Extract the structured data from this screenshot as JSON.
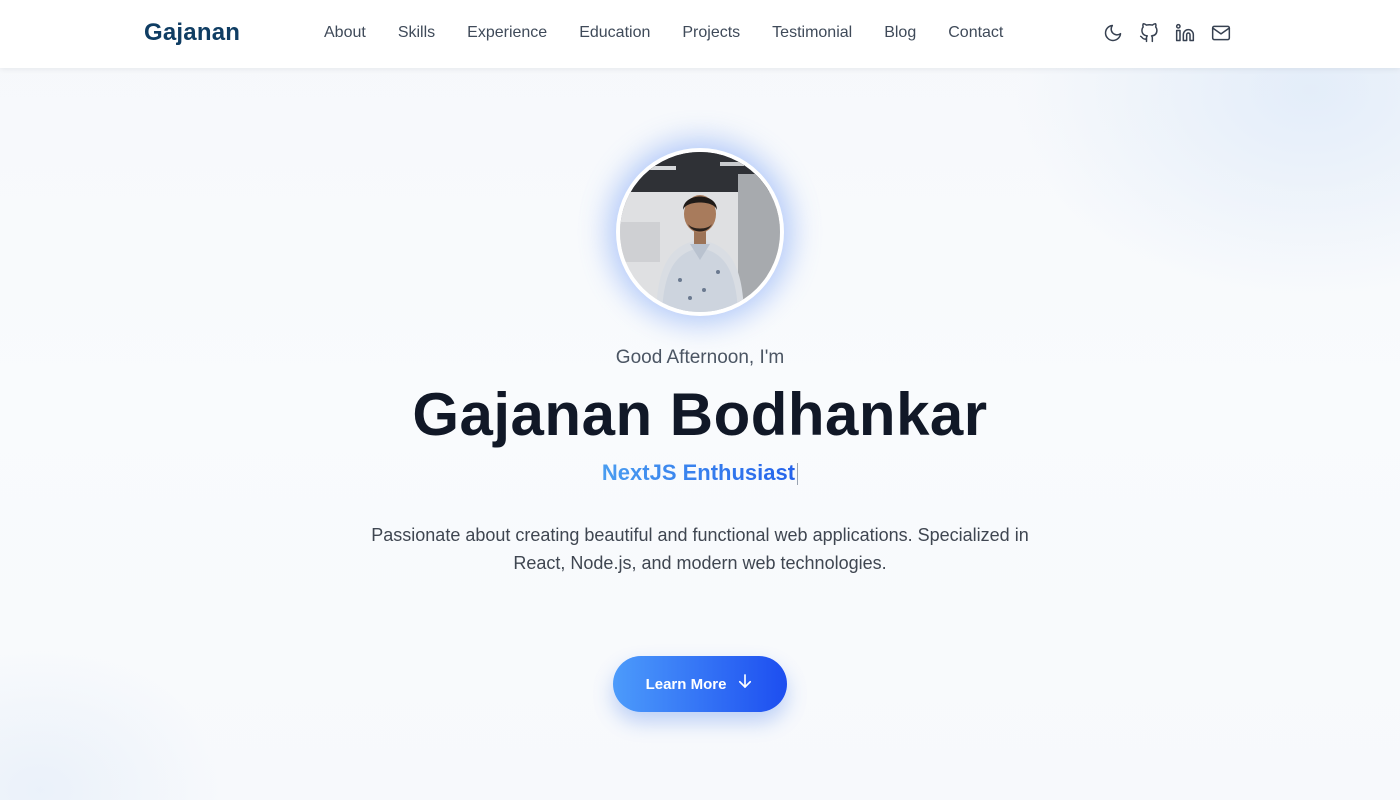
{
  "header": {
    "brand": "Gajanan",
    "nav": [
      {
        "label": "About"
      },
      {
        "label": "Skills"
      },
      {
        "label": "Experience"
      },
      {
        "label": "Education"
      },
      {
        "label": "Projects"
      },
      {
        "label": "Testimonial"
      },
      {
        "label": "Blog"
      },
      {
        "label": "Contact"
      }
    ],
    "icons": [
      "moon-icon",
      "github-icon",
      "linkedin-icon",
      "mail-icon"
    ]
  },
  "hero": {
    "avatar_icon": "profile-photo",
    "greeting": "Good Afternoon, I'm",
    "name": "Gajanan Bodhankar",
    "role": "NextJS Enthusiast",
    "bio": "Passionate about creating beautiful and functional web applications. Specialized in React, Node.js, and modern web technologies.",
    "cta_label": "Learn More",
    "cta_icon": "arrow-down-icon"
  },
  "colors": {
    "brand": "#0f3d63",
    "accent_start": "#4c9bfb",
    "accent_end": "#1d4ef0",
    "name_text": "#111827"
  }
}
